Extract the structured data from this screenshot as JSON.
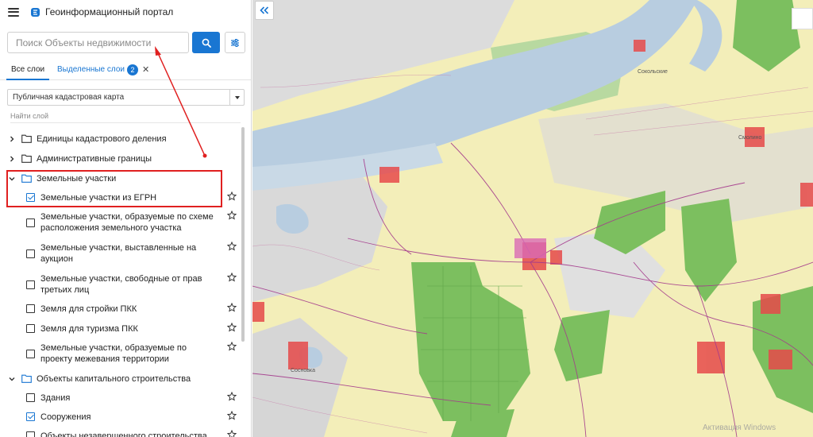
{
  "app": {
    "title": "Геоинформационный портал"
  },
  "search": {
    "placeholder": "Поиск Объекты недвижимости"
  },
  "tabs": {
    "all_layers": "Все слои",
    "selected_layers": "Выделенные слои",
    "selected_count": "2"
  },
  "basemap": {
    "selected": "Публичная кадастровая карта"
  },
  "layer_search": {
    "placeholder": "Найти слой"
  },
  "layer_tree": {
    "groups": [
      {
        "label": "Единицы кадастрового деления",
        "expanded": false
      },
      {
        "label": "Административные границы",
        "expanded": false
      },
      {
        "label": "Земельные участки",
        "expanded": true
      },
      {
        "label": "Объекты капитального строительства",
        "expanded": true
      }
    ],
    "land_layers": [
      {
        "label": "Земельные участки из ЕГРН",
        "checked": true
      },
      {
        "label": "Земельные участки, образуемые по схеме расположения земельного участка",
        "checked": false
      },
      {
        "label": "Земельные участки, выставленные на аукцион",
        "checked": false
      },
      {
        "label": "Земельные участки, свободные от прав третьих лиц",
        "checked": false
      },
      {
        "label": "Земля для стройки ПКК",
        "checked": false
      },
      {
        "label": "Земля для туризма ПКК",
        "checked": false
      },
      {
        "label": "Земельные участки, образуемые по проекту межевания территории",
        "checked": false
      }
    ],
    "oks_layers": [
      {
        "label": "Здания",
        "checked": false
      },
      {
        "label": "Сооружения",
        "checked": true
      },
      {
        "label": "Объекты незавершенного строительства",
        "checked": false
      }
    ]
  },
  "map": {
    "labels": [
      "Сокольские",
      "Смолино",
      "Сосновка"
    ],
    "watermark": "Активация Windows"
  },
  "colors": {
    "accent": "#1976d2",
    "annotation": "#e02020",
    "water": "#b8cde0",
    "forest": "#7cbf5f",
    "field": "#f3eeb9",
    "urban": "#e64a4a"
  }
}
